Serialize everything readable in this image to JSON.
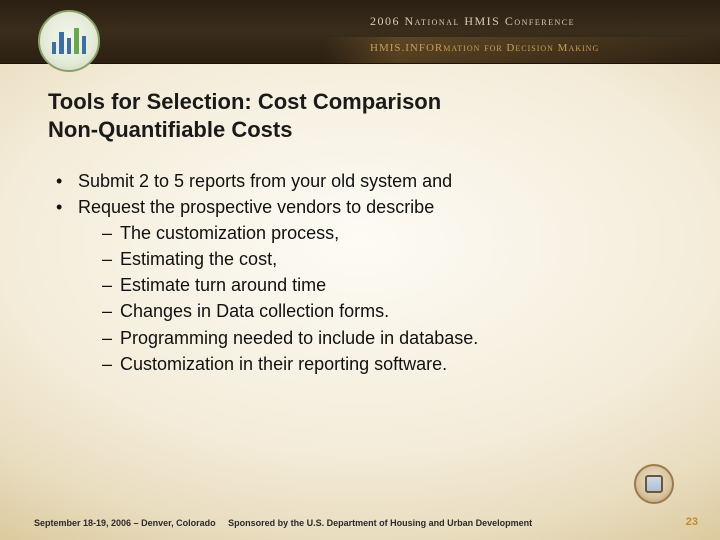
{
  "header": {
    "conference_line": "2006 National HMIS Conference",
    "tagline": "HMIS.INFORmation for Decision Making"
  },
  "title": {
    "line1": "Tools for Selection: Cost Comparison",
    "line2": "Non-Quantifiable Costs"
  },
  "bullets": [
    "Submit 2 to 5 reports from your old system and",
    "Request the prospective vendors to describe"
  ],
  "subbullets": [
    "The customization process,",
    "Estimating the cost,",
    "Estimate turn around time",
    "Changes in Data collection forms.",
    "Programming needed to include in database.",
    "Customization in their reporting software."
  ],
  "footer": {
    "date_location": "September 18-19, 2006 – Denver, Colorado",
    "sponsor": "Sponsored by the U.S. Department of Housing and Urban Development",
    "page_number": "23"
  }
}
